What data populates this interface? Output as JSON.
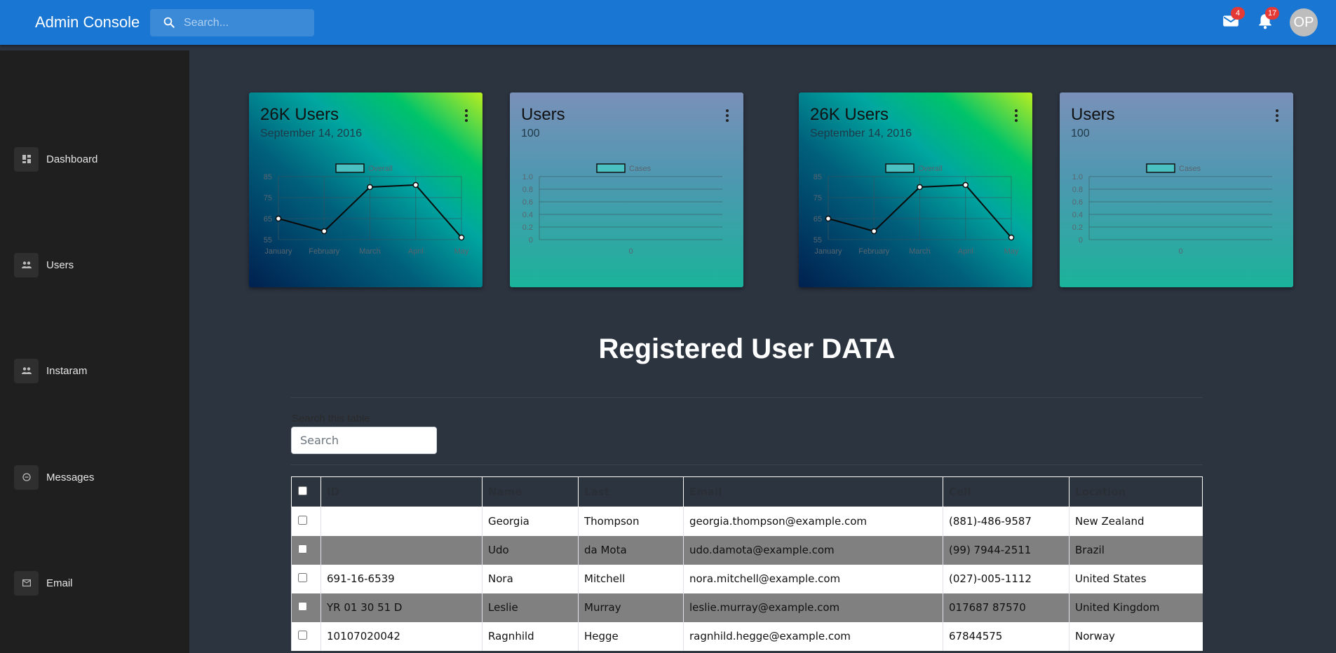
{
  "app": {
    "title": "Admin Console"
  },
  "search": {
    "placeholder": "Search..."
  },
  "notifications": {
    "mail_count": "4",
    "bell_count": "17",
    "avatar_initials": "OP"
  },
  "sidebar": {
    "items": [
      {
        "label": "Dashboard",
        "icon": "dashboard-icon"
      },
      {
        "label": "Users",
        "icon": "people-icon"
      },
      {
        "label": "Instaram",
        "icon": "people-icon"
      },
      {
        "label": "Messages",
        "icon": "chat-icon"
      },
      {
        "label": "Email",
        "icon": "email-icon"
      }
    ]
  },
  "cards": [
    {
      "title": "26K Users",
      "subtitle": "September 14, 2016",
      "chart_index": 0
    },
    {
      "title": "Users",
      "subtitle": "100",
      "chart_index": 1
    },
    {
      "title": "26K Users",
      "subtitle": "September 14, 2016",
      "chart_index": 2
    },
    {
      "title": "Users",
      "subtitle": "100",
      "chart_index": 3
    }
  ],
  "chart_data": [
    {
      "type": "line",
      "x": [
        "January",
        "February",
        "March",
        "April",
        "May"
      ],
      "series": [
        {
          "name": "Overall",
          "values": [
            65,
            59,
            80,
            81,
            56
          ]
        }
      ],
      "yticks": [
        55,
        65,
        75,
        85
      ],
      "ylim": [
        55,
        85
      ],
      "legend": "top",
      "grid": true
    },
    {
      "type": "line",
      "x": [
        "0"
      ],
      "series": [
        {
          "name": "Cases",
          "values": []
        }
      ],
      "yticks": [
        0,
        0.2,
        0.4,
        0.6,
        0.8,
        1.0
      ],
      "ylim": [
        0,
        1
      ],
      "legend": "top",
      "grid": true
    },
    {
      "type": "line",
      "x": [
        "January",
        "February",
        "March",
        "April",
        "May"
      ],
      "series": [
        {
          "name": "Overall",
          "values": [
            65,
            59,
            80,
            81,
            56
          ]
        }
      ],
      "yticks": [
        55,
        65,
        75,
        85
      ],
      "ylim": [
        55,
        85
      ],
      "legend": "top",
      "grid": true
    },
    {
      "type": "line",
      "x": [
        "0"
      ],
      "series": [
        {
          "name": "Cases",
          "values": []
        }
      ],
      "yticks": [
        0,
        0.2,
        0.4,
        0.6,
        0.8,
        1.0
      ],
      "ylim": [
        0,
        1
      ],
      "legend": "top",
      "grid": true
    }
  ],
  "main": {
    "heading": "Registered User DATA",
    "table_search_label": "Search this table",
    "table_search_placeholder": "Search",
    "columns": [
      "ID",
      "Name",
      "Last",
      "Email",
      "Cell",
      "Location"
    ],
    "rows": [
      [
        "",
        "Georgia",
        "Thompson",
        "georgia.thompson@example.com",
        "(881)-486-9587",
        "New Zealand"
      ],
      [
        "",
        "Udo",
        "da Mota",
        "udo.damota@example.com",
        "(99) 7944-2511",
        "Brazil"
      ],
      [
        "691-16-6539",
        "Nora",
        "Mitchell",
        "nora.mitchell@example.com",
        "(027)-005-1112",
        "United States"
      ],
      [
        "YR 01 30 51 D",
        "Leslie",
        "Murray",
        "leslie.murray@example.com",
        "017687 87570",
        "United Kingdom"
      ],
      [
        "10107020042",
        "Ragnhild",
        "Hegge",
        "ragnhild.hegge@example.com",
        "67844575",
        "Norway"
      ]
    ]
  },
  "colors": {
    "topbar": "#1976d2",
    "sidebar": "#1f1f1f",
    "background": "#2c3440",
    "badge": "#e53935",
    "legend_box": "#4bc0c0"
  }
}
